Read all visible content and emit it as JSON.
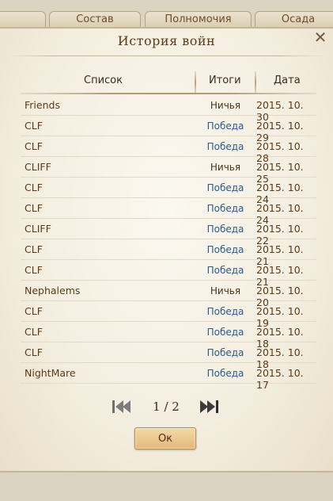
{
  "background_tabs": [
    "",
    "Состав",
    "Полномочия",
    "Осада"
  ],
  "dialog": {
    "title": "История войн",
    "close_label": "✕"
  },
  "table": {
    "headers": {
      "list": "Список",
      "result": "Итоги",
      "date": "Дата"
    },
    "rows": [
      {
        "name": "Friends",
        "result": "Ничья",
        "date": "2015. 10. 30",
        "type": "draw"
      },
      {
        "name": "CLF",
        "result": "Победа",
        "date": "2015. 10. 29",
        "type": "win"
      },
      {
        "name": "CLF",
        "result": "Победа",
        "date": "2015. 10. 28",
        "type": "win"
      },
      {
        "name": "CLIFF",
        "result": "Ничья",
        "date": "2015. 10. 25",
        "type": "draw"
      },
      {
        "name": "CLF",
        "result": "Победа",
        "date": "2015. 10. 24",
        "type": "win"
      },
      {
        "name": "CLF",
        "result": "Победа",
        "date": "2015. 10. 24",
        "type": "win"
      },
      {
        "name": "CLIFF",
        "result": "Победа",
        "date": "2015. 10. 22",
        "type": "win"
      },
      {
        "name": "CLF",
        "result": "Победа",
        "date": "2015. 10. 21",
        "type": "win"
      },
      {
        "name": "CLF",
        "result": "Победа",
        "date": "2015. 10. 21",
        "type": "win"
      },
      {
        "name": "Nephalems",
        "result": "Ничья",
        "date": "2015. 10. 20",
        "type": "draw"
      },
      {
        "name": "CLF",
        "result": "Победа",
        "date": "2015. 10. 19",
        "type": "win"
      },
      {
        "name": "CLF",
        "result": "Победа",
        "date": "2015. 10. 18",
        "type": "win"
      },
      {
        "name": "CLF",
        "result": "Победа",
        "date": "2015. 10. 18",
        "type": "win"
      },
      {
        "name": "NightMare",
        "result": "Победа",
        "date": "2015. 10. 17",
        "type": "win"
      }
    ]
  },
  "pager": {
    "indicator": "1 / 2"
  },
  "ok_label": "Ок",
  "colors": {
    "win": "#2c5a8a",
    "draw": "#4a3418",
    "accent": "#e4b978"
  }
}
